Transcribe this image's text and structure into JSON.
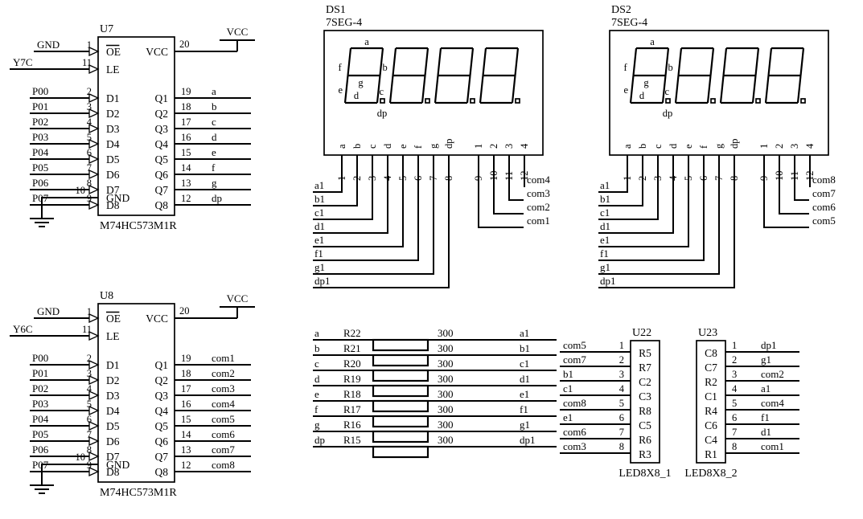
{
  "sheet": {
    "background": "#ffffff",
    "ink": "#000000"
  },
  "latch_u7": {
    "refdes": "U7",
    "part": "M74HC573M1R",
    "power_label": "VCC",
    "power_pin": "20",
    "gnd_pin_label": "GND",
    "gnd_pin_num": "10",
    "control_pins": [
      {
        "net": "GND",
        "num": "1",
        "name": "OE",
        "overbar": true
      },
      {
        "net": "Y7C",
        "num": "11",
        "name": "LE",
        "overbar": false
      }
    ],
    "inputs": [
      {
        "net": "P00",
        "num": "2",
        "name": "D1"
      },
      {
        "net": "P01",
        "num": "3",
        "name": "D2"
      },
      {
        "net": "P02",
        "num": "4",
        "name": "D3"
      },
      {
        "net": "P03",
        "num": "5",
        "name": "D4"
      },
      {
        "net": "P04",
        "num": "6",
        "name": "D5"
      },
      {
        "net": "P05",
        "num": "7",
        "name": "D6"
      },
      {
        "net": "P06",
        "num": "8",
        "name": "D7"
      },
      {
        "net": "P07",
        "num": "9",
        "name": "D8"
      }
    ],
    "outputs": [
      {
        "name": "Q1",
        "num": "19",
        "net": "a"
      },
      {
        "name": "Q2",
        "num": "18",
        "net": "b"
      },
      {
        "name": "Q3",
        "num": "17",
        "net": "c"
      },
      {
        "name": "Q4",
        "num": "16",
        "net": "d"
      },
      {
        "name": "Q5",
        "num": "15",
        "net": "e"
      },
      {
        "name": "Q6",
        "num": "14",
        "net": "f"
      },
      {
        "name": "Q7",
        "num": "13",
        "net": "g"
      },
      {
        "name": "Q8",
        "num": "12",
        "net": "dp"
      }
    ],
    "vcc_pin_name": "VCC"
  },
  "latch_u8": {
    "refdes": "U8",
    "part": "M74HC573M1R",
    "power_label": "VCC",
    "power_pin": "20",
    "gnd_pin_label": "GND",
    "gnd_pin_num": "10",
    "control_pins": [
      {
        "net": "GND",
        "num": "1",
        "name": "OE",
        "overbar": true
      },
      {
        "net": "Y6C",
        "num": "11",
        "name": "LE",
        "overbar": false
      }
    ],
    "inputs": [
      {
        "net": "P00",
        "num": "2",
        "name": "D1"
      },
      {
        "net": "P01",
        "num": "3",
        "name": "D2"
      },
      {
        "net": "P02",
        "num": "4",
        "name": "D3"
      },
      {
        "net": "P03",
        "num": "5",
        "name": "D4"
      },
      {
        "net": "P04",
        "num": "6",
        "name": "D5"
      },
      {
        "net": "P05",
        "num": "7",
        "name": "D6"
      },
      {
        "net": "P06",
        "num": "8",
        "name": "D7"
      },
      {
        "net": "P07",
        "num": "9",
        "name": "D8"
      }
    ],
    "outputs": [
      {
        "name": "Q1",
        "num": "19",
        "net": "com1"
      },
      {
        "name": "Q2",
        "num": "18",
        "net": "com2"
      },
      {
        "name": "Q3",
        "num": "17",
        "net": "com3"
      },
      {
        "name": "Q4",
        "num": "16",
        "net": "com4"
      },
      {
        "name": "Q5",
        "num": "15",
        "net": "com5"
      },
      {
        "name": "Q6",
        "num": "14",
        "net": "com6"
      },
      {
        "name": "Q7",
        "num": "13",
        "net": "com7"
      },
      {
        "name": "Q8",
        "num": "12",
        "net": "com8"
      }
    ],
    "vcc_pin_name": "VCC"
  },
  "display_ds1": {
    "refdes": "DS1",
    "part": "7SEG-4",
    "segment_labels": [
      "a",
      "b",
      "c",
      "d",
      "e",
      "f",
      "g",
      "dp"
    ],
    "digit_count": 4,
    "segment_pin_names": [
      "a",
      "b",
      "c",
      "d",
      "e",
      "f",
      "g",
      "dp"
    ],
    "segment_pin_nums": [
      "1",
      "2",
      "3",
      "4",
      "5",
      "6",
      "7",
      "8"
    ],
    "segment_nets": [
      "a1",
      "b1",
      "c1",
      "d1",
      "e1",
      "f1",
      "g1",
      "dp1"
    ],
    "digit_pin_names": [
      "1",
      "2",
      "3",
      "4"
    ],
    "digit_pin_nums": [
      "9",
      "10",
      "11",
      "12"
    ],
    "digit_nets": [
      "com1",
      "com2",
      "com3",
      "com4"
    ]
  },
  "display_ds2": {
    "refdes": "DS2",
    "part": "7SEG-4",
    "segment_labels": [
      "a",
      "b",
      "c",
      "d",
      "e",
      "f",
      "g",
      "dp"
    ],
    "digit_count": 4,
    "segment_pin_names": [
      "a",
      "b",
      "c",
      "d",
      "e",
      "f",
      "g",
      "dp"
    ],
    "segment_pin_nums": [
      "1",
      "2",
      "3",
      "4",
      "5",
      "6",
      "7",
      "8"
    ],
    "segment_nets": [
      "a1",
      "b1",
      "c1",
      "d1",
      "e1",
      "f1",
      "g1",
      "dp1"
    ],
    "digit_pin_names": [
      "1",
      "2",
      "3",
      "4"
    ],
    "digit_pin_nums": [
      "9",
      "10",
      "11",
      "12"
    ],
    "digit_nets": [
      "com5",
      "com6",
      "com7",
      "com8"
    ]
  },
  "resistor_network": {
    "rows": [
      {
        "left_net": "a",
        "refdes": "R22",
        "value": "300",
        "right_net": "a1"
      },
      {
        "left_net": "b",
        "refdes": "R21",
        "value": "300",
        "right_net": "b1"
      },
      {
        "left_net": "c",
        "refdes": "R20",
        "value": "300",
        "right_net": "c1"
      },
      {
        "left_net": "d",
        "refdes": "R19",
        "value": "300",
        "right_net": "d1"
      },
      {
        "left_net": "e",
        "refdes": "R18",
        "value": "300",
        "right_net": "e1"
      },
      {
        "left_net": "f",
        "refdes": "R17",
        "value": "300",
        "right_net": "f1"
      },
      {
        "left_net": "g",
        "refdes": "R16",
        "value": "300",
        "right_net": "g1"
      },
      {
        "left_net": "dp",
        "refdes": "R15",
        "value": "300",
        "right_net": "dp1"
      }
    ]
  },
  "matrix_u22": {
    "refdes": "U22",
    "part": "LED8X8_1",
    "pins": [
      {
        "net": "com5",
        "num": "1",
        "name": "R5"
      },
      {
        "net": "com7",
        "num": "2",
        "name": "R7"
      },
      {
        "net": "b1",
        "num": "3",
        "name": "C2"
      },
      {
        "net": "c1",
        "num": "4",
        "name": "C3"
      },
      {
        "net": "com8",
        "num": "5",
        "name": "R8"
      },
      {
        "net": "e1",
        "num": "6",
        "name": "C5"
      },
      {
        "net": "com6",
        "num": "7",
        "name": "R6"
      },
      {
        "net": "com3",
        "num": "8",
        "name": "R3"
      }
    ]
  },
  "matrix_u23": {
    "refdes": "U23",
    "part": "LED8X8_2",
    "pins": [
      {
        "name": "C8",
        "num": "1",
        "net": "dp1"
      },
      {
        "name": "C7",
        "num": "2",
        "net": "g1"
      },
      {
        "name": "R2",
        "num": "3",
        "net": "com2"
      },
      {
        "name": "C1",
        "num": "4",
        "net": "a1"
      },
      {
        "name": "R4",
        "num": "5",
        "net": "com4"
      },
      {
        "name": "C6",
        "num": "6",
        "net": "f1"
      },
      {
        "name": "C4",
        "num": "7",
        "net": "d1"
      },
      {
        "name": "R1",
        "num": "8",
        "net": "com1"
      }
    ]
  }
}
